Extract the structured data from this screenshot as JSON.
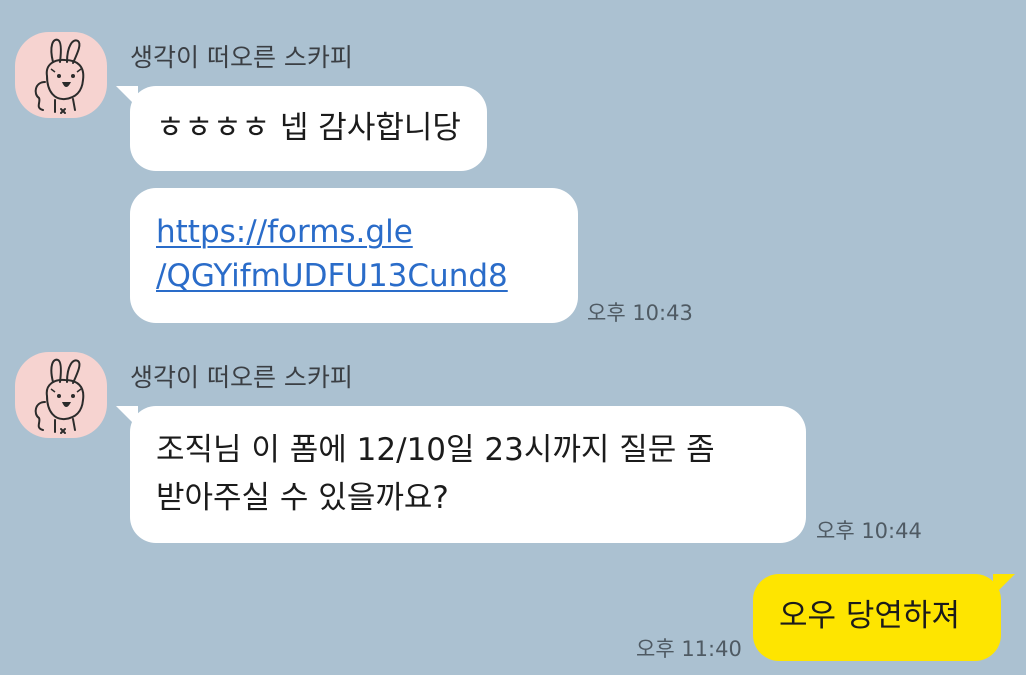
{
  "messages": [
    {
      "sender": "생각이 떠오른 스카피",
      "bubbles": [
        {
          "lines": [
            "ㅎㅎㅎㅎ 넵 감사합니당"
          ]
        },
        {
          "lines": [
            "https://forms.gle",
            "/QGYifmUDFU13Cund8"
          ],
          "is_link": true
        }
      ],
      "time": "오후 10:43",
      "avatar_icon": "rabbit-avatar-icon"
    },
    {
      "sender": "생각이 떠오른 스카피",
      "bubbles": [
        {
          "lines": [
            "조직님 이 폼에 12/10일 23시까지 질문 좀",
            "받아주실 수 있을까요?"
          ]
        }
      ],
      "time": "오후 10:44",
      "avatar_icon": "rabbit-avatar-icon"
    },
    {
      "sender": "me",
      "bubbles": [
        {
          "lines": [
            "오우 당연하져"
          ]
        }
      ],
      "time": "오후 11:40"
    }
  ],
  "colors": {
    "background": "#abc1d1",
    "incoming_bubble": "#ffffff",
    "outgoing_bubble": "#fee500",
    "link": "#2a6cc9",
    "avatar_bg": "#f6d3d0"
  }
}
